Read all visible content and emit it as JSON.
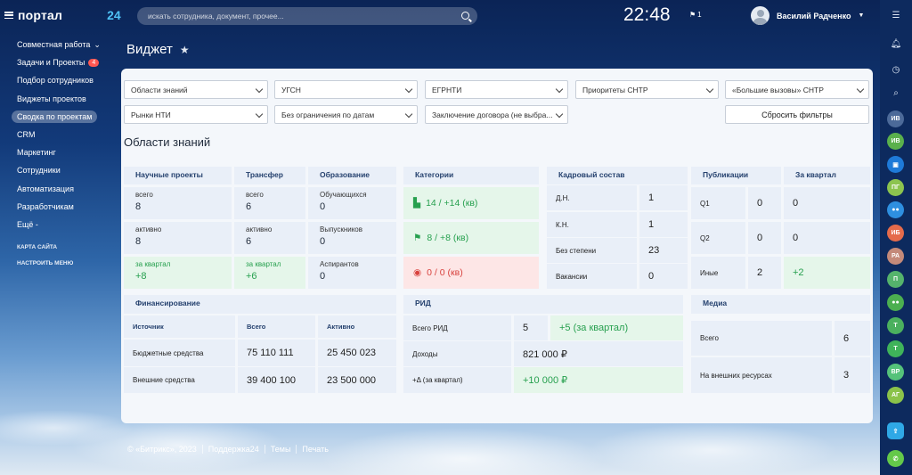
{
  "header": {
    "logo": "портал",
    "logo_num": "24",
    "search_placeholder": "искать сотрудника, документ, прочее...",
    "clock": "22:48",
    "flag_count": "1",
    "user_name": "Василий Радченко"
  },
  "menu": {
    "items": [
      {
        "label": "Совместная работа",
        "caret": "⌄"
      },
      {
        "label": "Задачи и Проекты",
        "badge": "4"
      },
      {
        "label": "Подбор сотрудников"
      },
      {
        "label": "Виджеты проектов"
      },
      {
        "label": "Сводка по проектам"
      },
      {
        "label": "CRM"
      },
      {
        "label": "Маркетинг"
      },
      {
        "label": "Сотрудники"
      },
      {
        "label": "Автоматизация"
      },
      {
        "label": "Разработчикам"
      },
      {
        "label": "Ещё -"
      }
    ],
    "small": [
      "КАРТА САЙТА",
      "НАСТРОИТЬ МЕНЮ"
    ]
  },
  "page": {
    "title": "Виджет"
  },
  "filters": {
    "row1": [
      "Области знаний",
      "УГСН",
      "ЕГРНТИ",
      "Приоритеты СНТР",
      "«Большие вызовы» СНТР"
    ],
    "row2": [
      "Рынки НТИ",
      "Без ограничения по датам",
      "Заключение договора (не выбра..."
    ],
    "reset": "Сбросить фильтры"
  },
  "section": {
    "title": "Области знаний"
  },
  "projects": {
    "h1": "Научные проекты",
    "h2": "Трансфер",
    "h3": "Образование",
    "r1": {
      "a_l": "всего",
      "a_v": "8",
      "b_l": "всего",
      "b_v": "6",
      "c_l": "Обучающихся",
      "c_v": "0"
    },
    "r2": {
      "a_l": "активно",
      "a_v": "8",
      "b_l": "активно",
      "b_v": "6",
      "c_l": "Выпускников",
      "c_v": "0"
    },
    "r3": {
      "a_l": "за квартал",
      "a_v": "+8",
      "b_l": "за квартал",
      "b_v": "+6",
      "c_l": "Аспирантов",
      "c_v": "0"
    }
  },
  "categories": {
    "h": "Категории",
    "c1": "14 / +14 (кв)",
    "c2": "8 / +8 (кв)",
    "c3": "0 / 0 (кв)"
  },
  "staff": {
    "h": "Кадровый состав",
    "rows": [
      {
        "l": "Д.Н.",
        "v": "1"
      },
      {
        "l": "К.Н.",
        "v": "1"
      },
      {
        "l": "Без степени",
        "v": "23"
      },
      {
        "l": "Вакансии",
        "v": "0"
      }
    ]
  },
  "publications": {
    "h1": "Публикации",
    "h2": "За квартал",
    "rows": [
      {
        "l": "Q1",
        "v": "0",
        "q": "0"
      },
      {
        "l": "Q2",
        "v": "0",
        "q": "0"
      },
      {
        "l": "Иные",
        "v": "2",
        "q": "+2"
      }
    ]
  },
  "finance": {
    "h": "Финансирование",
    "cols": [
      "Источник",
      "Всего",
      "Активно"
    ],
    "rows": [
      {
        "l": "Бюджетные средства",
        "t": "75 110 111",
        "a": "25 450 023"
      },
      {
        "l": "Внешние средства",
        "t": "39 400 100",
        "a": "23 500 000"
      }
    ]
  },
  "rid": {
    "h": "РИД",
    "r1_l": "Всего РИД",
    "r1_v": "5",
    "r1_q": "+5 (за квартал)",
    "r2_l": "Доходы",
    "r2_v": "821 000 ₽",
    "r3_l": "+Δ (за квартал)",
    "r3_v": "+10 000 ₽"
  },
  "media": {
    "h": "Медиа",
    "rows": [
      {
        "l": "Всего",
        "v": "6"
      },
      {
        "l": "На внешних ресурсах",
        "v": "3"
      }
    ]
  },
  "footer": {
    "items": [
      "© «Битрикс», 2023",
      "Поддержка24",
      "Темы",
      "Печать"
    ]
  },
  "right_panel": {
    "avatars": [
      {
        "t": "ИВ",
        "c": "#5ab04c"
      },
      {
        "t": "ПГ",
        "c": "#8cc44f"
      },
      {
        "t": "ИБ",
        "c": "#e56b4b"
      },
      {
        "t": "РА",
        "c": "#c48a7a"
      },
      {
        "t": "П",
        "c": "#55b36c"
      },
      {
        "t": "Т",
        "c": "#4bb05e"
      },
      {
        "t": "Т",
        "c": "#3fb35a"
      },
      {
        "t": "ВР",
        "c": "#55c27a"
      },
      {
        "t": "АГ",
        "c": "#8bc34a"
      }
    ]
  }
}
